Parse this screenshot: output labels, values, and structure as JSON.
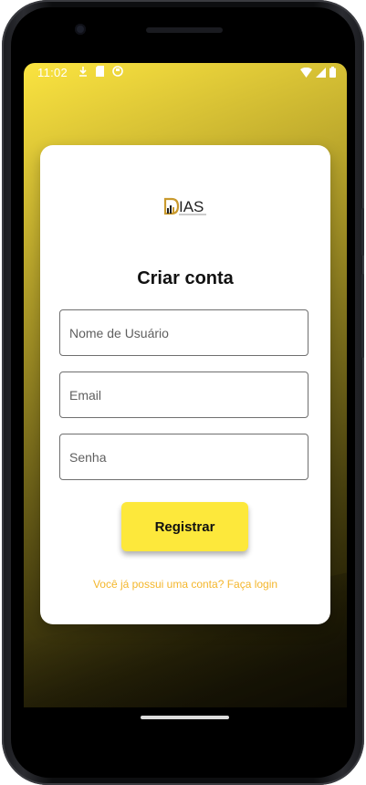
{
  "status_bar": {
    "time": "11:02"
  },
  "logo": {
    "text": "IAS"
  },
  "form": {
    "title": "Criar conta",
    "username_placeholder": "Nome de Usuário",
    "email_placeholder": "Email",
    "password_placeholder": "Senha",
    "submit_label": "Registrar",
    "login_link": "Você já possui uma conta? Faça login"
  },
  "colors": {
    "accent": "#fde83b",
    "link": "#f4b62b"
  }
}
